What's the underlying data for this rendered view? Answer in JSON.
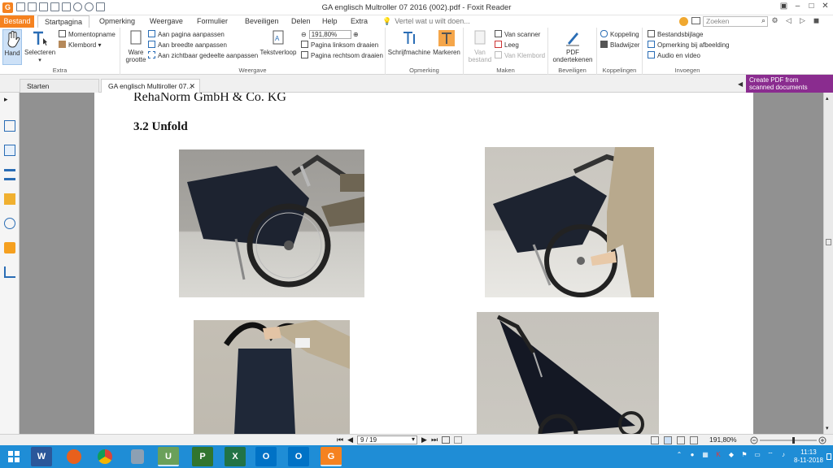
{
  "window": {
    "title": "GA englisch Multroller 07 2016 (002).pdf - Foxit Reader"
  },
  "menu": {
    "file": "Bestand",
    "tabs": [
      "Startpagina",
      "Opmerking",
      "Weergave",
      "Formulier",
      "Beveiligen",
      "Delen",
      "Help",
      "Extra"
    ],
    "tell_me": "Vertel wat u wilt doen...",
    "search_placeholder": "Zoeken"
  },
  "ribbon": {
    "hand": "Hand",
    "select": "Selecteren",
    "snapshot": "Momentopname",
    "clipboard": "Klembord",
    "group_extra": "Extra",
    "actual_size": [
      "Ware",
      "grootte"
    ],
    "fit_page": "Aan pagina aanpassen",
    "fit_width": "Aan breedte aanpassen",
    "fit_visible": "Aan zichtbaar gedeelte aanpassen",
    "reflow": "Tekstverloop",
    "zoom_value": "191,80%",
    "rotate_left": "Pagina linksom draaien",
    "rotate_right": "Pagina rechtsom draaien",
    "group_view": "Weergave",
    "typewriter": "Schrijfmachine",
    "highlight": "Markeren",
    "group_comment": "Opmerking",
    "from_file": [
      "Van",
      "bestand"
    ],
    "from_scanner": "Van scanner",
    "blank": "Leeg",
    "from_clipboard": "Van Klembord",
    "group_create": "Maken",
    "sign_pdf": [
      "PDF",
      "ondertekenen"
    ],
    "group_protect": "Beveiligen",
    "link": "Koppeling",
    "bookmark": "Bladwijzer",
    "group_links": "Koppelingen",
    "file_attachment": "Bestandsbijlage",
    "image_annotation": "Opmerking bij afbeelding",
    "audio_video": "Audio en video",
    "group_insert": "Invoegen"
  },
  "tabs": {
    "start": "Starten",
    "document": "GA englisch Multiroller 07...",
    "promo": [
      "Create PDF from",
      "scanned documents"
    ]
  },
  "document": {
    "company": "RehaNorm GmbH & Co. KG",
    "section": "3.2 Unfold"
  },
  "status": {
    "page": "9 / 19",
    "zoom": "191,80%"
  },
  "taskbar": {
    "apps": [
      "start-icon",
      "word-icon",
      "firefox-icon",
      "chrome-icon",
      "foxit-icon",
      "uk-app-icon",
      "project-icon",
      "excel-icon",
      "outlook-icon",
      "outlook2-icon",
      "foxit-reader-icon"
    ],
    "time": "11:13",
    "date": "8-11-2018"
  },
  "colors": {
    "accent": "#f58220",
    "taskbar": "#1f8dd6",
    "promo": "#8a2c8f"
  }
}
